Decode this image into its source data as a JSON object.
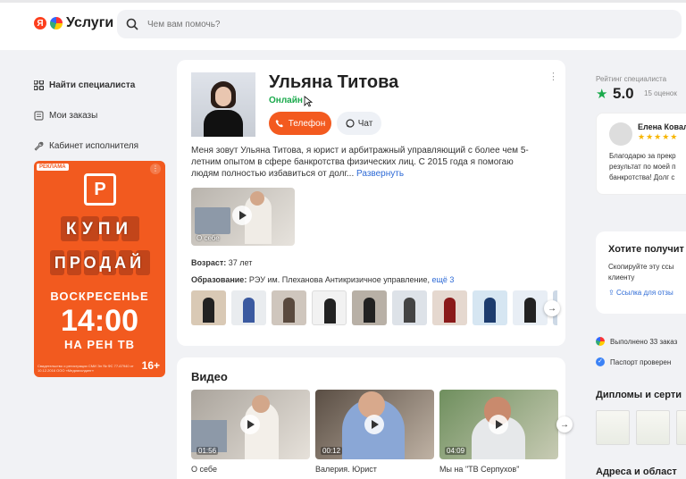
{
  "header": {
    "logo_text": "Услуги",
    "logo_letter": "Я",
    "search_placeholder": "Чем вам помочь?"
  },
  "sidebar": {
    "items": [
      {
        "label": "Найти специалиста"
      },
      {
        "label": "Мои заказы"
      },
      {
        "label": "Кабинет исполнителя"
      }
    ]
  },
  "ad": {
    "tag": "РЕКЛАМА",
    "word1": "КУПИ",
    "word2": "ПРОДАЙ",
    "day": "ВОСКРЕСЕНЬЕ",
    "time": "14:00",
    "channel": "НА РЕН ТВ",
    "age": "16+",
    "fine_print": "Свидетельство о регистрации СМИ Эл № ФС 77-67940 от 10.12.2016 ООО «Медиахолдинг»"
  },
  "profile": {
    "name": "Ульяна Титова",
    "status": "Онлайн",
    "phone_button": "Телефон",
    "chat_button": "Чат",
    "bio": "Меня зовут Ульяна Титова, я юрист и арбитражный управляющий с более чем 5-летним опытом в сфере банкротства физических лиц. С 2015 года я помогаю людям полностью избавиться от долг...",
    "bio_more": "Развернуть",
    "video_label": "О себе",
    "age_label": "Возраст:",
    "age_value": "37 лет",
    "education_label": "Образование:",
    "education_value": "РЭУ им. Плеханова Антикризичное управление,",
    "education_more": "ещё 3"
  },
  "videos": {
    "title": "Видео",
    "items": [
      {
        "time": "01:56",
        "caption": "О себе"
      },
      {
        "time": "00:12",
        "caption": "Валерия. Юрист"
      },
      {
        "time": "04:09",
        "caption": "Мы на \"ТВ Серпухов\""
      }
    ]
  },
  "rating": {
    "label": "Рейтинг специалиста",
    "score": "5.0",
    "count": "15 оценок",
    "reviewer": "Елена Ковал",
    "stars": "★★★★★",
    "review_text": "Благодарю за прекр результат по моей п банкротства! Долг с"
  },
  "want": {
    "title": "Хотите получит",
    "text": "Скопируйте эту ссы клиенту",
    "link": "Ссылка для отзы"
  },
  "badges": {
    "completed": "Выполнено 33 заказ",
    "passport": "Паспорт проверен"
  },
  "sections": {
    "diplomas": "Дипломы и серти",
    "areas": "Адреса и област"
  },
  "colors": {
    "accent": "#f35a1f",
    "online": "#19a94b",
    "link": "#2d6ad6"
  }
}
